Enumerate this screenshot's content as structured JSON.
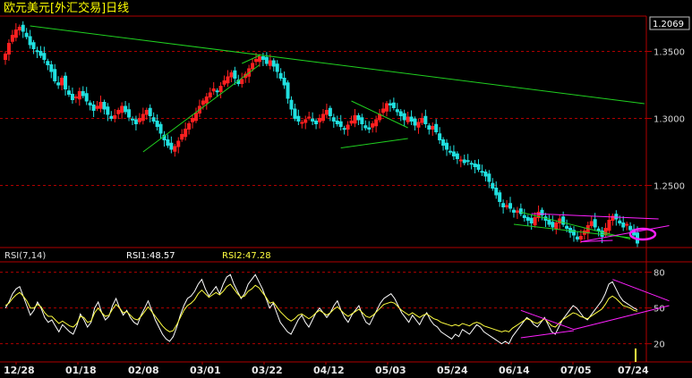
{
  "title": "欧元美元[外汇交易]日线",
  "price_label": "1.2069",
  "rsi_labels": {
    "main": "RSI(7,14)",
    "rsi1": "RSI1:48.57",
    "rsi2": "RSI2:47.28"
  },
  "colors": {
    "up": "#ff2020",
    "down": "#20e0e0",
    "grid": "#b00000",
    "trend_green": "#20d020",
    "trend_magenta": "#ff20ff",
    "rsi1": "#ffffff",
    "rsi2": "#ffff40",
    "title": "#ffff00"
  },
  "chart_data": [
    {
      "type": "candlestick",
      "title": "欧元美元[外汇交易]日线",
      "ylim": [
        1.205,
        1.375
      ],
      "y_ticks": [
        1.25,
        1.3,
        1.35
      ],
      "y_tick_labels": [
        "1.2500",
        "1.3000",
        "1.3500"
      ],
      "x_tick_labels": [
        "12/28",
        "01/18",
        "02/08",
        "03/01",
        "03/22",
        "04/12",
        "05/03",
        "05/24",
        "06/14",
        "07/05",
        "07/24"
      ],
      "last_price": 1.2069,
      "closes": [
        1.348,
        1.356,
        1.362,
        1.366,
        1.368,
        1.365,
        1.361,
        1.355,
        1.352,
        1.35,
        1.347,
        1.344,
        1.34,
        1.335,
        1.328,
        1.325,
        1.33,
        1.322,
        1.318,
        1.314,
        1.316,
        1.32,
        1.317,
        1.313,
        1.31,
        1.306,
        1.309,
        1.312,
        1.307,
        1.303,
        1.3,
        1.302,
        1.306,
        1.309,
        1.305,
        1.301,
        1.299,
        1.296,
        1.3,
        1.303,
        1.306,
        1.302,
        1.298,
        1.294,
        1.289,
        1.284,
        1.28,
        1.277,
        1.279,
        1.283,
        1.288,
        1.292,
        1.296,
        1.3,
        1.304,
        1.309,
        1.313,
        1.316,
        1.319,
        1.322,
        1.32,
        1.324,
        1.328,
        1.331,
        1.334,
        1.33,
        1.326,
        1.329,
        1.333,
        1.337,
        1.341,
        1.344,
        1.346,
        1.344,
        1.341,
        1.343,
        1.339,
        1.335,
        1.33,
        1.325,
        1.315,
        1.307,
        1.3,
        1.298,
        1.297,
        1.299,
        1.301,
        1.298,
        1.296,
        1.3,
        1.303,
        1.306,
        1.302,
        1.298,
        1.296,
        1.294,
        1.292,
        1.295,
        1.298,
        1.302,
        1.299,
        1.296,
        1.293,
        1.292,
        1.296,
        1.299,
        1.303,
        1.307,
        1.311,
        1.31,
        1.308,
        1.305,
        1.302,
        1.299,
        1.301,
        1.298,
        1.295,
        1.297,
        1.3,
        1.296,
        1.292,
        1.294,
        1.29,
        1.284,
        1.28,
        1.277,
        1.275,
        1.272,
        1.27,
        1.269,
        1.267,
        1.268,
        1.266,
        1.264,
        1.262,
        1.26,
        1.257,
        1.253,
        1.248,
        1.243,
        1.238,
        1.234,
        1.235,
        1.233,
        1.23,
        1.231,
        1.229,
        1.226,
        1.224,
        1.222,
        1.226,
        1.23,
        1.228,
        1.224,
        1.221,
        1.219,
        1.222,
        1.225,
        1.221,
        1.218,
        1.215,
        1.213,
        1.21,
        1.212,
        1.216,
        1.22,
        1.223,
        1.219,
        1.216,
        1.212,
        1.218,
        1.224,
        1.227,
        1.225,
        1.222,
        1.219,
        1.221,
        1.217,
        1.213,
        1.207
      ]
    },
    {
      "type": "line",
      "title": "RSI(7,14)",
      "ylim": [
        10,
        85
      ],
      "y_ticks": [
        20,
        50,
        80
      ],
      "series": [
        {
          "name": "RSI1",
          "last": 48.57,
          "values": [
            50,
            55,
            62,
            66,
            68,
            60,
            52,
            44,
            48,
            55,
            50,
            42,
            38,
            40,
            35,
            30,
            36,
            33,
            30,
            28,
            35,
            45,
            40,
            34,
            38,
            50,
            55,
            46,
            40,
            43,
            52,
            58,
            50,
            44,
            48,
            42,
            38,
            36,
            44,
            50,
            56,
            48,
            40,
            34,
            28,
            24,
            22,
            26,
            34,
            44,
            52,
            58,
            60,
            64,
            70,
            74,
            66,
            60,
            64,
            68,
            62,
            70,
            76,
            78,
            70,
            64,
            58,
            62,
            70,
            74,
            78,
            72,
            66,
            58,
            50,
            54,
            46,
            38,
            34,
            30,
            28,
            34,
            40,
            44,
            38,
            34,
            40,
            46,
            50,
            46,
            42,
            46,
            52,
            56,
            48,
            42,
            38,
            44,
            48,
            52,
            44,
            38,
            36,
            42,
            48,
            54,
            58,
            60,
            62,
            58,
            52,
            46,
            42,
            38,
            44,
            40,
            36,
            42,
            46,
            40,
            36,
            34,
            30,
            28,
            26,
            24,
            28,
            26,
            32,
            30,
            28,
            32,
            36,
            34,
            30,
            28,
            26,
            24,
            22,
            20,
            22,
            20,
            26,
            30,
            34,
            38,
            42,
            40,
            36,
            34,
            38,
            42,
            36,
            30,
            28,
            34,
            40,
            44,
            48,
            52,
            50,
            46,
            42,
            40,
            44,
            48,
            52,
            56,
            62,
            70,
            72,
            66,
            60,
            56,
            54,
            52,
            50,
            48.57
          ]
        },
        {
          "name": "RSI2",
          "last": 47.28,
          "values": [
            52,
            54,
            58,
            61,
            63,
            60,
            56,
            50,
            50,
            53,
            51,
            46,
            43,
            43,
            40,
            37,
            39,
            37,
            35,
            34,
            37,
            43,
            42,
            38,
            39,
            46,
            50,
            46,
            43,
            44,
            49,
            53,
            50,
            46,
            47,
            44,
            41,
            40,
            43,
            47,
            51,
            47,
            43,
            39,
            35,
            32,
            30,
            31,
            36,
            42,
            48,
            52,
            54,
            57,
            62,
            65,
            62,
            59,
            61,
            63,
            61,
            64,
            68,
            70,
            66,
            62,
            59,
            60,
            64,
            66,
            69,
            67,
            63,
            59,
            54,
            55,
            51,
            47,
            44,
            41,
            39,
            41,
            44,
            45,
            43,
            41,
            43,
            46,
            48,
            46,
            44,
            46,
            49,
            51,
            48,
            45,
            43,
            45,
            47,
            49,
            46,
            43,
            42,
            44,
            47,
            50,
            53,
            54,
            55,
            54,
            51,
            48,
            46,
            44,
            46,
            44,
            42,
            44,
            45,
            43,
            41,
            40,
            38,
            37,
            36,
            35,
            36,
            35,
            37,
            36,
            35,
            37,
            38,
            37,
            35,
            34,
            33,
            32,
            31,
            30,
            31,
            30,
            33,
            35,
            37,
            39,
            41,
            40,
            38,
            37,
            39,
            41,
            38,
            35,
            34,
            37,
            40,
            42,
            44,
            46,
            45,
            43,
            42,
            41,
            43,
            45,
            47,
            49,
            53,
            58,
            60,
            58,
            55,
            52,
            51,
            50,
            48,
            47.28
          ]
        }
      ]
    }
  ]
}
